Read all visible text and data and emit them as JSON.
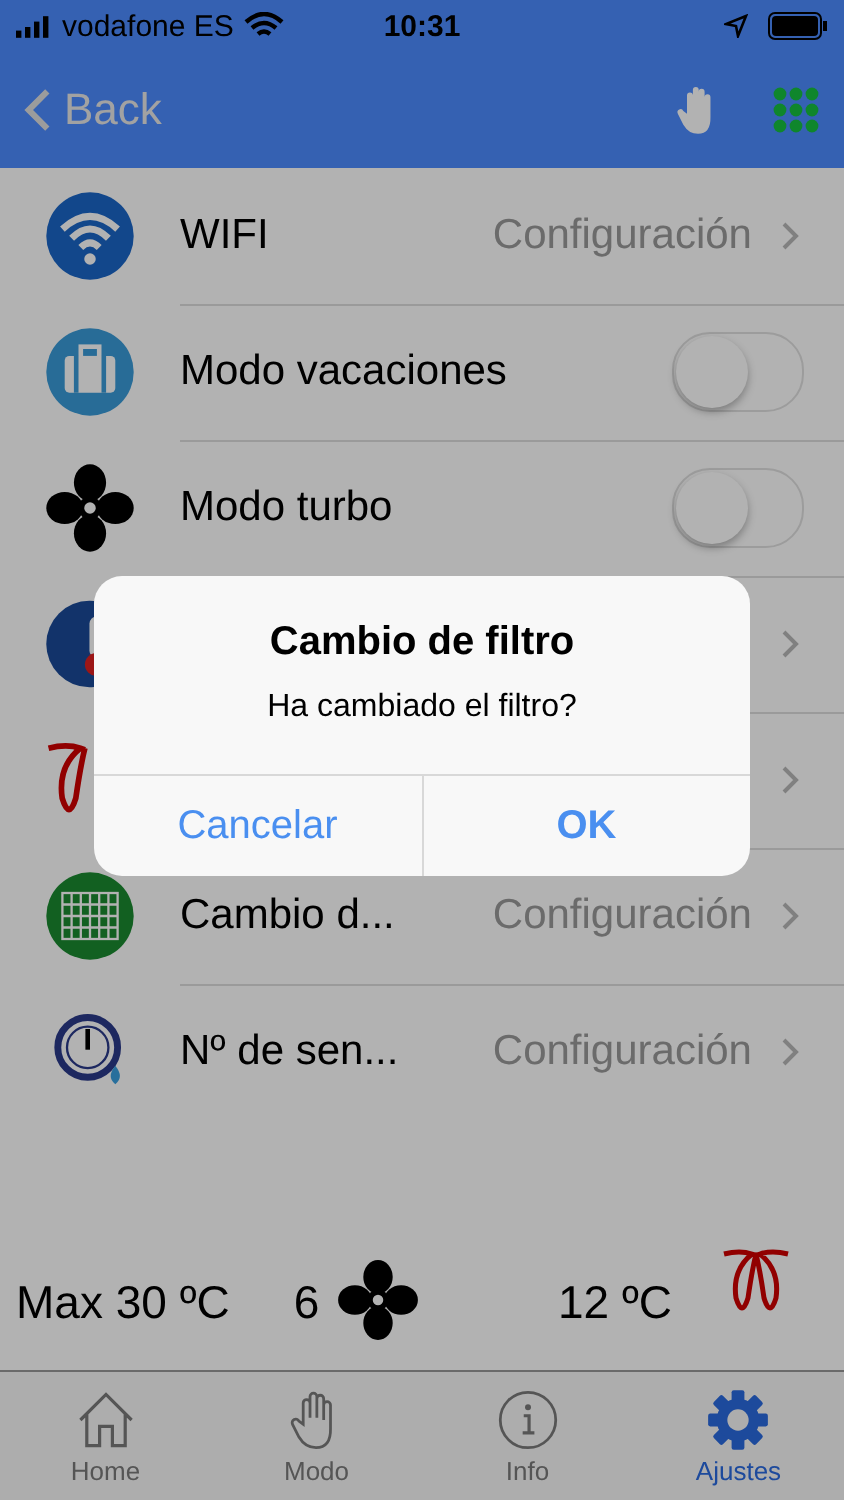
{
  "status_bar": {
    "carrier": "vodafone ES",
    "time": "10:31"
  },
  "nav": {
    "back": "Back"
  },
  "settings": [
    {
      "kind": "link",
      "title": "WIFI",
      "value": "Configuración"
    },
    {
      "kind": "toggle",
      "title": "Modo vacaciones",
      "on": false
    },
    {
      "kind": "toggle",
      "title": "Modo turbo",
      "on": false
    },
    {
      "kind": "link"
    },
    {
      "kind": "link"
    },
    {
      "kind": "link",
      "title": "Cambio d...",
      "value": "Configuración"
    },
    {
      "kind": "link",
      "title": "Nº de sen...",
      "value": "Configuración"
    }
  ],
  "summary": {
    "max_temp": "Max 30 ºC",
    "fan_speed": "6",
    "temp": "12 ºC"
  },
  "tabs": [
    {
      "label": "Home",
      "selected": false
    },
    {
      "label": "Modo",
      "selected": false
    },
    {
      "label": "Info",
      "selected": false
    },
    {
      "label": "Ajustes",
      "selected": true
    }
  ],
  "dialog": {
    "title": "Cambio de filtro",
    "message": "Ha cambiado el filtro?",
    "buttons": [
      {
        "label": "Cancelar",
        "kind": "cancel"
      },
      {
        "label": "OK",
        "kind": "default"
      }
    ]
  }
}
